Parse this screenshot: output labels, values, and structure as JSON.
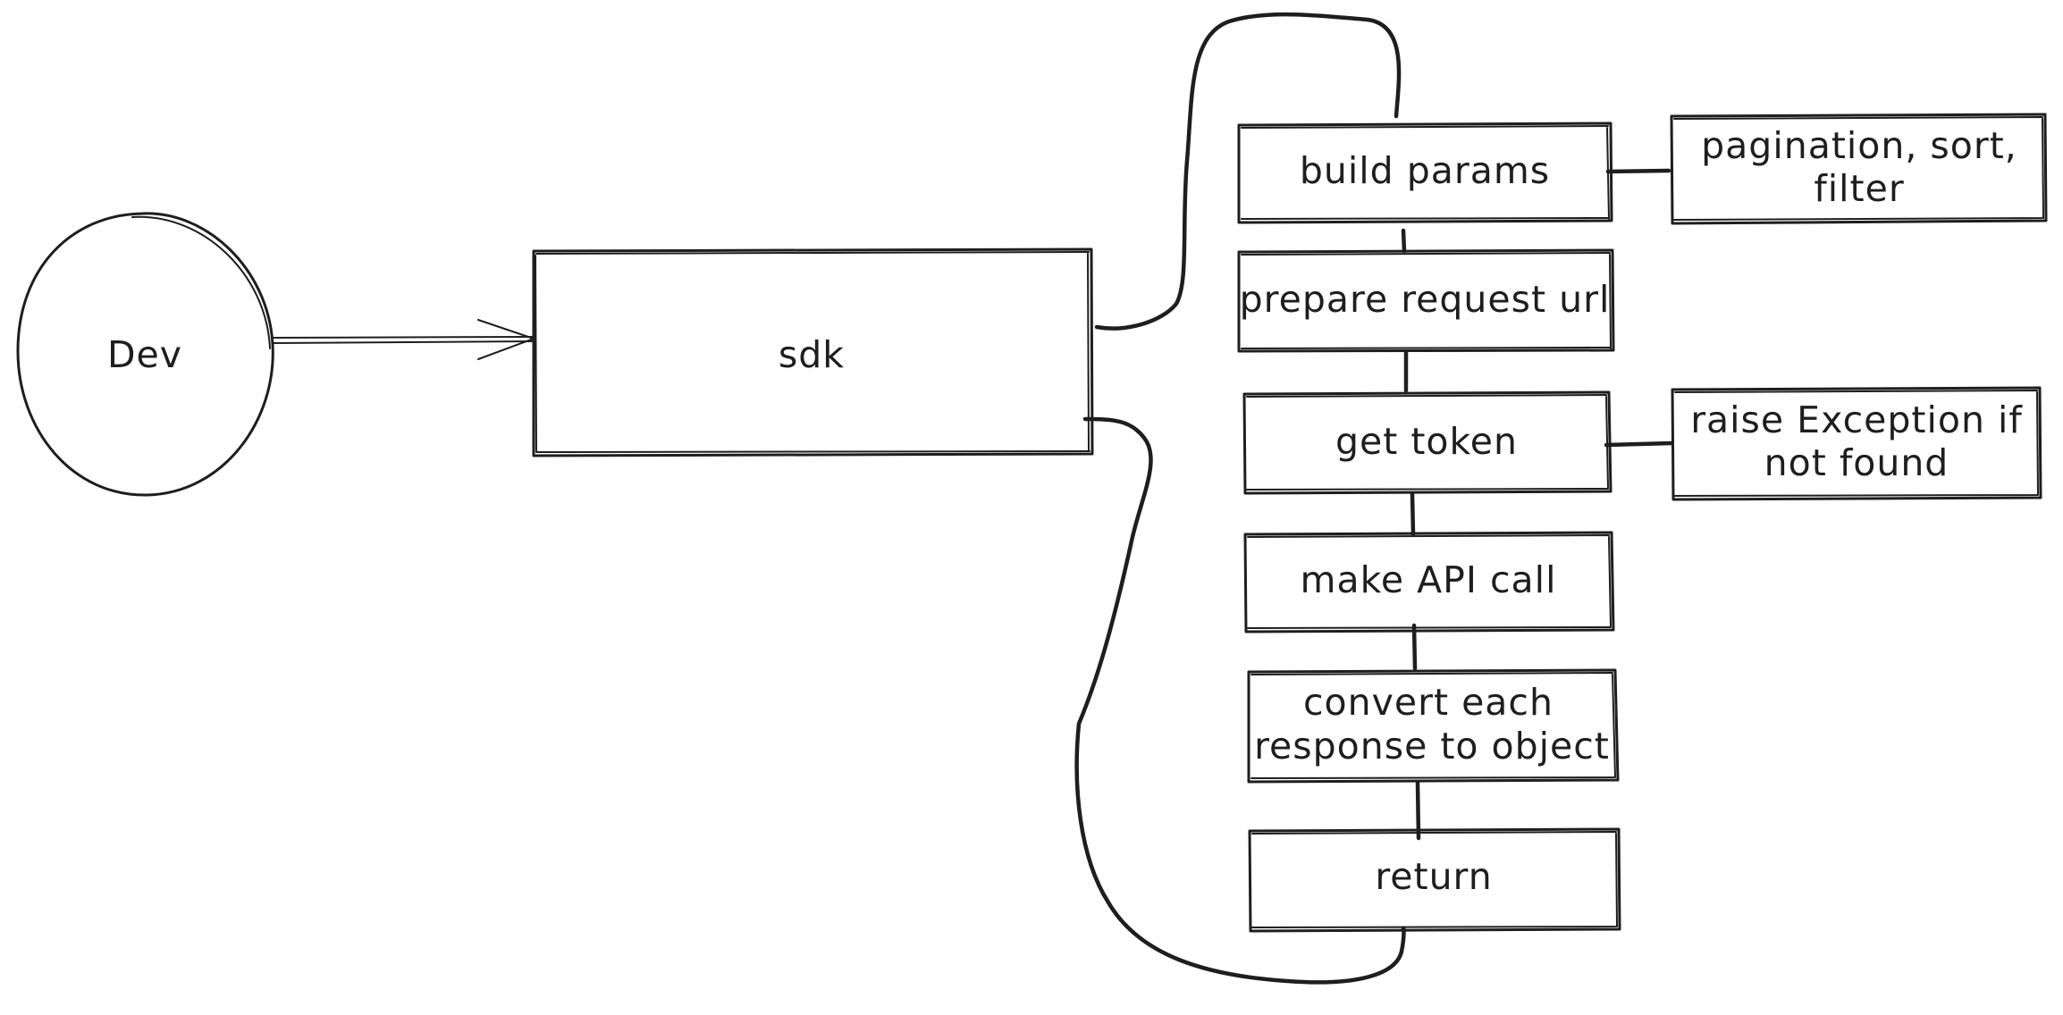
{
  "nodes": {
    "dev": "Dev",
    "sdk": "sdk",
    "build_params": "build params",
    "prepare_request_url": "prepare request url",
    "get_token": "get token",
    "make_api_call": "make API call",
    "convert_line1": "convert each",
    "convert_line2": "response to object",
    "return": "return"
  },
  "notes": {
    "pagination_line1": "pagination, sort,",
    "pagination_line2": "filter",
    "exception_line1": "raise Exception if",
    "exception_line2": "not found"
  },
  "colors": {
    "stroke": "#1e1e1e",
    "background": "#ffffff"
  }
}
